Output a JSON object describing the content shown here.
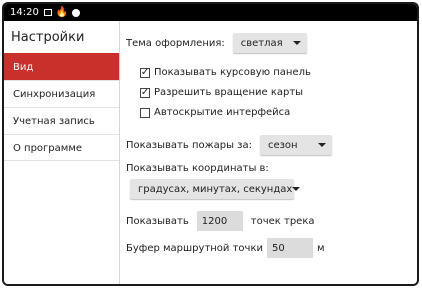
{
  "statusbar": {
    "time": "14:20",
    "icons": [
      "image-icon",
      "fire-icon",
      "circle-icon"
    ]
  },
  "sidebar": {
    "title": "Настройки",
    "items": [
      {
        "label": "Вид",
        "active": true
      },
      {
        "label": "Синхронизация",
        "active": false
      },
      {
        "label": "Учетная запись",
        "active": false
      },
      {
        "label": "О программе",
        "active": false
      }
    ]
  },
  "settings": {
    "theme_label": "Тема оформления:",
    "theme_value": "светлая",
    "checkboxes": [
      {
        "label": "Показывать курсовую панель",
        "checked": true
      },
      {
        "label": "Разрешить вращение карты",
        "checked": true
      },
      {
        "label": "Автоскрытие интерфейса",
        "checked": false
      }
    ],
    "fires_label": "Показывать пожары за:",
    "fires_value": "сезон",
    "coords_label": "Показывать координаты в:",
    "coords_value": "градусах, минутах, секундах",
    "track_prefix": "Показывать",
    "track_value": "1200",
    "track_suffix": "точек трека",
    "buffer_label": "Буфер маршрутной точки",
    "buffer_value": "50",
    "buffer_unit": "м"
  },
  "colors": {
    "accent": "#c9302c"
  }
}
